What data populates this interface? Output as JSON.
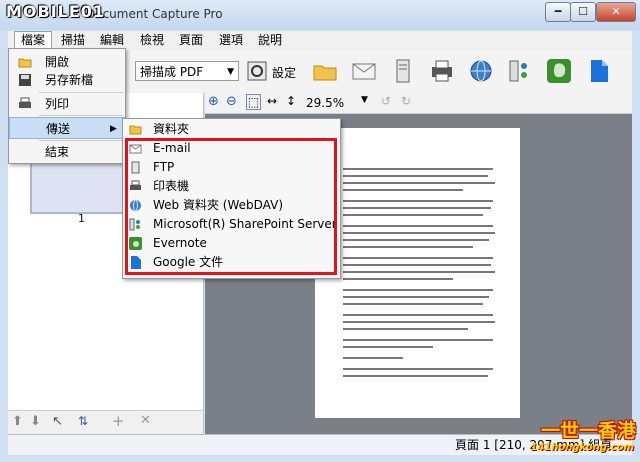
{
  "watermark": {
    "text": "MOBILE01"
  },
  "window": {
    "title": "Document Capture Pro",
    "min": "━",
    "max": "☐",
    "close": "✕"
  },
  "menubar": {
    "items": [
      "檔案",
      "掃描",
      "編輯",
      "檢視",
      "頁面",
      "選項",
      "說明"
    ]
  },
  "toolbar": {
    "scan_to_label": "掃描成 PDF",
    "settings_label": "設定"
  },
  "zoom": {
    "value": "29.5%"
  },
  "thumbnail": {
    "page_number": "1"
  },
  "file_menu": {
    "items": [
      {
        "label": "開啟",
        "icon": "folder-icon"
      },
      {
        "label": "另存新檔",
        "icon": "save-icon"
      },
      {
        "label": "列印",
        "icon": "printer-icon"
      },
      {
        "label": "傳送",
        "icon": "send-icon",
        "highlighted": true,
        "has_submenu": true
      },
      {
        "label": "結束",
        "icon": "exit-icon"
      }
    ]
  },
  "send_menu": {
    "items": [
      {
        "label": "資料夾",
        "icon": "folder-icon"
      },
      {
        "label": "E-mail",
        "icon": "email-icon"
      },
      {
        "label": "FTP",
        "icon": "ftp-icon"
      },
      {
        "label": "印表機",
        "icon": "printer-icon"
      },
      {
        "label": "Web 資料夾 (WebDAV)",
        "icon": "globe-icon"
      },
      {
        "label": "Microsoft(R) SharePoint Server",
        "icon": "sharepoint-icon"
      },
      {
        "label": "Evernote",
        "icon": "evernote-icon"
      },
      {
        "label": "Google 文件",
        "icon": "google-docs-icon"
      }
    ]
  },
  "status": {
    "text": "頁面 1 [210, 297 mm]  組頁"
  },
  "logo": {
    "line1": "一世一香港",
    "line2": "141hongkong.com"
  },
  "colors": {
    "highlight": "#c9ddf5",
    "red_box": "#e0141c"
  }
}
